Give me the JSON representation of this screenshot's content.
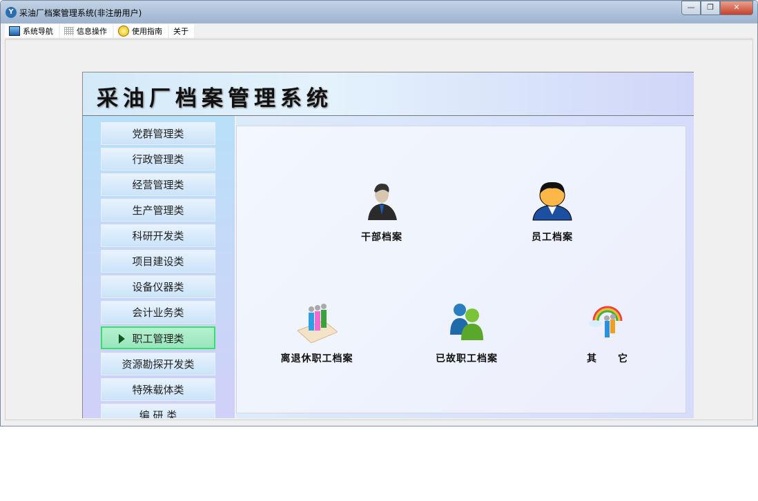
{
  "window": {
    "title": "采油厂档案管理系统(非注册用户)",
    "app_icon": "Y",
    "minimize": "—",
    "restore": "❐",
    "close": "✕"
  },
  "menu": [
    {
      "label": "系统导航",
      "icon": "window-icon"
    },
    {
      "label": "信息操作",
      "icon": "grid-icon"
    },
    {
      "label": "使用指南",
      "icon": "help-icon"
    },
    {
      "label": "关于"
    }
  ],
  "header": {
    "title": "采油厂档案管理系统"
  },
  "sidebar": {
    "items": [
      "党群管理类",
      "行政管理类",
      "经营管理类",
      "生产管理类",
      "科研开发类",
      "项目建设类",
      "设备仪器类",
      "会计业务类",
      "职工管理类",
      "资源勘探开发类",
      "特殊载体类",
      "编 研 类"
    ],
    "active_index": 8
  },
  "main": {
    "items": [
      {
        "label": "干部档案",
        "icon": "cadre-icon"
      },
      {
        "label": "员工档案",
        "icon": "employee-icon"
      },
      {
        "label": "离退休职工档案",
        "icon": "retired-icon"
      },
      {
        "label": "已故职工档案",
        "icon": "deceased-icon"
      },
      {
        "label": "其　　它",
        "icon": "other-icon"
      }
    ]
  }
}
